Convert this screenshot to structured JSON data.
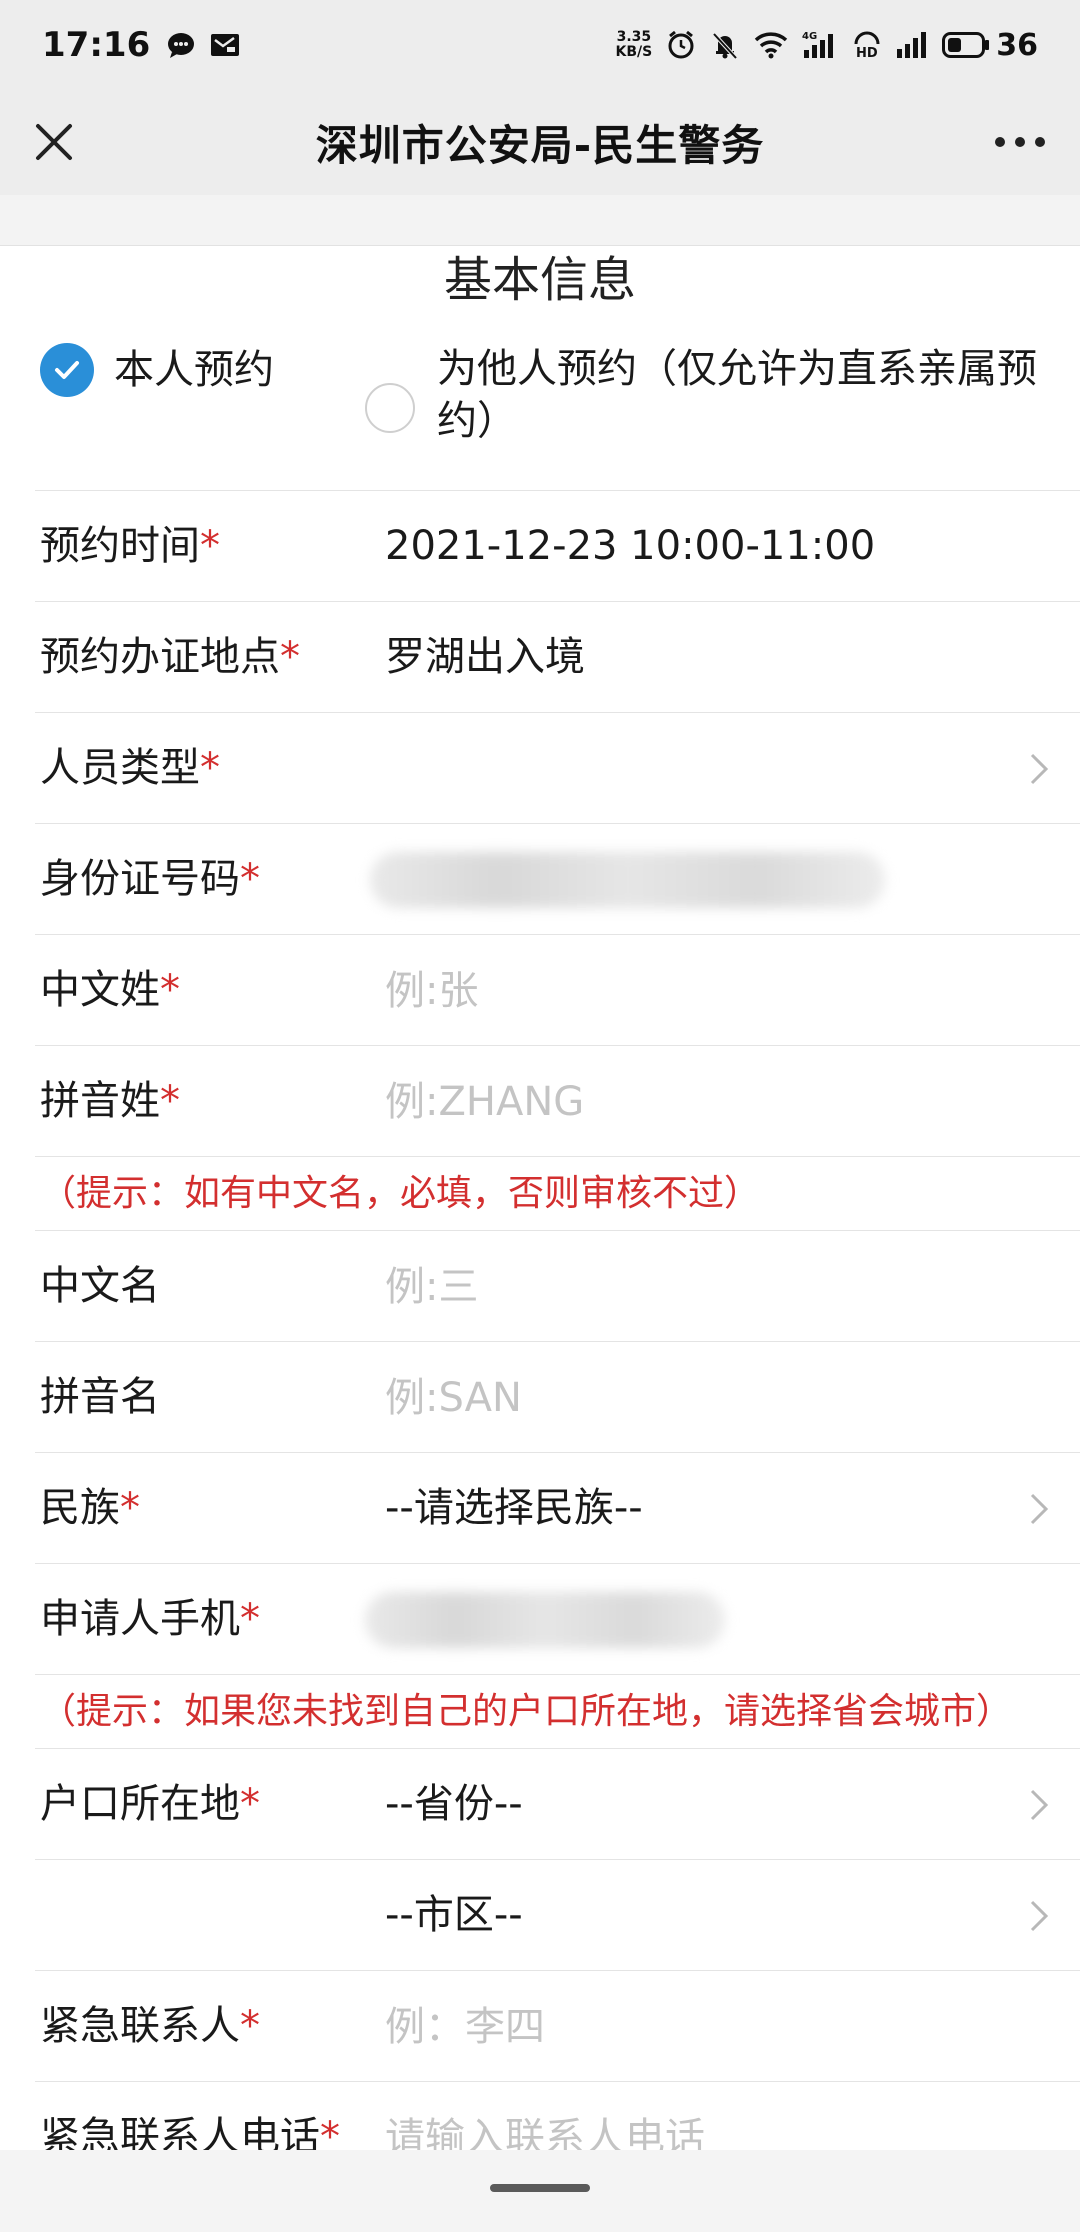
{
  "status_bar": {
    "time": "17:16",
    "net_speed_value": "3.35",
    "net_speed_unit": "KB/S",
    "battery": "36"
  },
  "nav": {
    "title": "深圳市公安局-民生警务"
  },
  "form": {
    "section_title": "基本信息",
    "booking_type": {
      "self_label": "本人预约",
      "other_label": "为他人预约（仅允许为直系亲属预约）",
      "selected": "self"
    },
    "appointment_time": {
      "label": "预约时间",
      "value": "2021-12-23 10:00-11:00"
    },
    "appointment_location": {
      "label": "预约办证地点",
      "value": "罗湖出入境"
    },
    "person_type": {
      "label": "人员类型",
      "value": ""
    },
    "id_number": {
      "label": "身份证号码"
    },
    "chinese_surname": {
      "label": "中文姓",
      "placeholder": "例:张"
    },
    "pinyin_surname": {
      "label": "拼音姓",
      "placeholder": "例:ZHANG"
    },
    "hint_name": "（提示：如有中文名，必填，否则审核不过）",
    "chinese_given_name": {
      "label": "中文名",
      "placeholder": "例:三"
    },
    "pinyin_given_name": {
      "label": "拼音名",
      "placeholder": "例:SAN"
    },
    "ethnicity": {
      "label": "民族",
      "value": "--请选择民族--"
    },
    "applicant_phone": {
      "label": "申请人手机"
    },
    "hint_hukou": "（提示：如果您未找到自己的户口所在地，请选择省会城市）",
    "hukou": {
      "label": "户口所在地",
      "province": "--省份--",
      "city": "--市区--"
    },
    "emergency_contact": {
      "label": "紧急联系人",
      "placeholder": "例：李四"
    },
    "emergency_phone": {
      "label": "紧急联系人电话",
      "placeholder": "请输入联系人电话"
    }
  },
  "required_mark": "*",
  "colors": {
    "accent_blue": "#2a8fd8",
    "required_red": "#d32f2f",
    "placeholder_gray": "#c4c4c4",
    "nav_background": "#ededed"
  },
  "icons": {
    "close": "close-icon",
    "more": "more-dots-icon",
    "chevron": "chevron-right-icon",
    "check": "check-icon"
  }
}
